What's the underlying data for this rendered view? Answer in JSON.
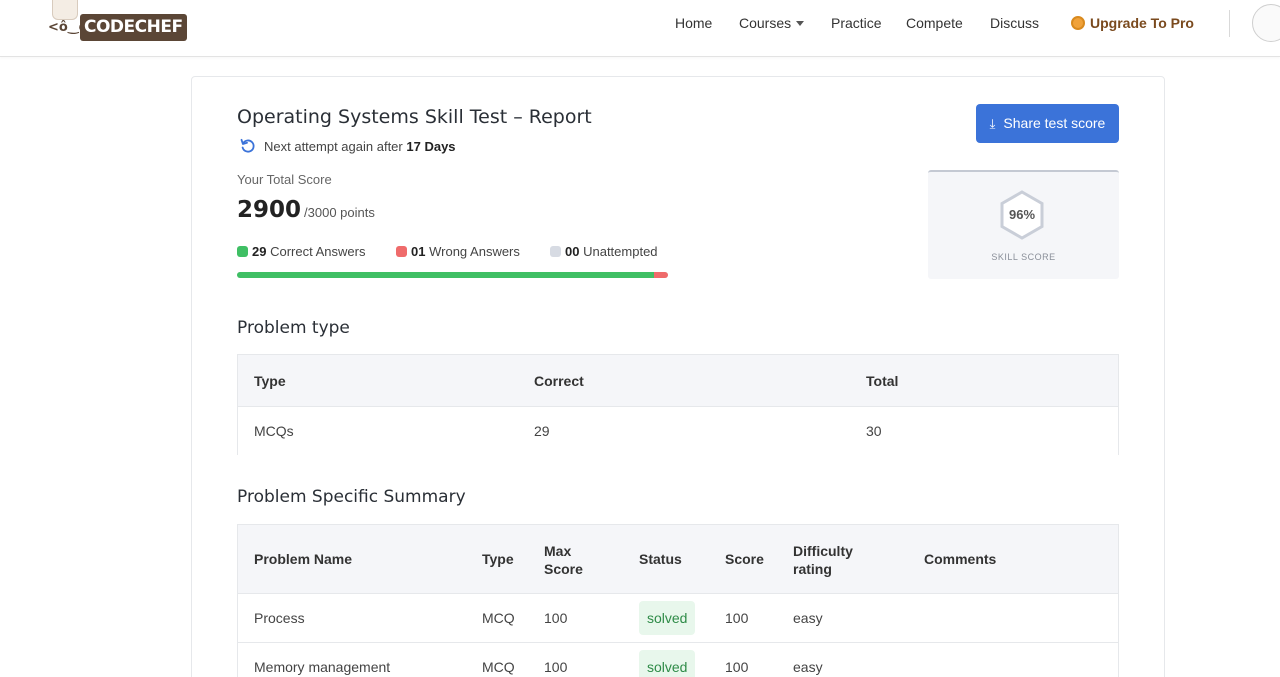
{
  "header": {
    "logo_text": "CODECHEF",
    "logo_face": "<ô‿ô>",
    "nav": {
      "home": "Home",
      "courses": "Courses",
      "practice": "Practice",
      "compete": "Compete",
      "discuss": "Discuss",
      "upgrade": "Upgrade To Pro"
    }
  },
  "report": {
    "title": "Operating Systems Skill Test – Report",
    "attempt_prefix": "Next attempt again after",
    "attempt_days": "17 Days",
    "total_label": "Your Total Score",
    "score": "2900",
    "score_max": "/3000 points",
    "correct_count": "29",
    "correct_label": "Correct Answers",
    "wrong_count": "01",
    "wrong_label": "Wrong Answers",
    "unattempted_count": "00",
    "unattempted_label": "Unattempted",
    "progress": {
      "correct_fraction": 0.967,
      "wrong_fraction": 0.033
    },
    "share_label": "Share test score",
    "skill_pct": "96%",
    "skill_label": "SKILL SCORE"
  },
  "problem_type": {
    "title": "Problem type",
    "headers": {
      "type": "Type",
      "correct": "Correct",
      "total": "Total"
    },
    "rows": [
      {
        "type": "MCQs",
        "correct": "29",
        "total": "30"
      }
    ]
  },
  "summary": {
    "title": "Problem Specific Summary",
    "headers": {
      "name": "Problem Name",
      "type": "Type",
      "max_line1": "Max",
      "max_line2": "Score",
      "status": "Status",
      "score": "Score",
      "difficulty_line1": "Difficulty",
      "difficulty_line2": "rating",
      "comments": "Comments"
    },
    "rows": [
      {
        "name": "Process",
        "type": "MCQ",
        "max": "100",
        "status": "solved",
        "score": "100",
        "difficulty": "easy"
      },
      {
        "name": "Memory management",
        "type": "MCQ",
        "max": "100",
        "status": "solved",
        "score": "100",
        "difficulty": "easy"
      }
    ]
  },
  "colors": {
    "accent": "#3b73d9",
    "correct": "#3fbf64",
    "wrong": "#ef6b6b",
    "unattempted": "#d7dbe3",
    "solved_bg": "#e8f7ec",
    "solved_text": "#2e8b47",
    "brand_brown": "#5b4636"
  }
}
